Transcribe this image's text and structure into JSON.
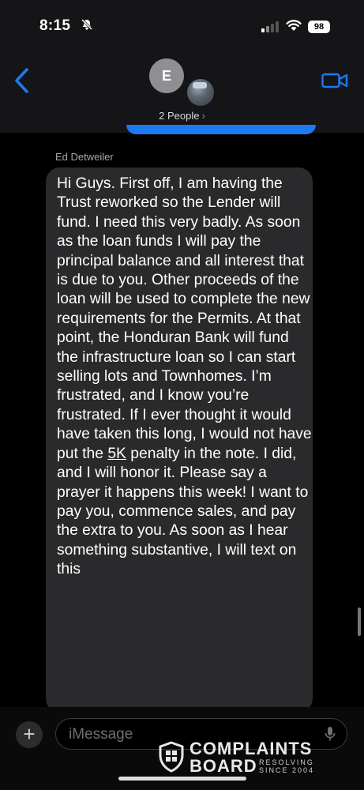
{
  "status_bar": {
    "time": "8:15",
    "battery": "98"
  },
  "header": {
    "avatar_initial": "E",
    "group_label": "2 People",
    "group_chevron": "›",
    "back_icon": "chevron-left-icon",
    "video_icon": "video-camera-icon"
  },
  "thread": {
    "sender_name": "Ed Detweiler",
    "message_before_underline": "Hi Guys.  First off, I am having the Trust reworked so the Lender will fund.  I need this very badly.  As soon as the loan funds I will pay the principal balance and all interest that is due to you.  Other proceeds of the loan will be used to complete the new requirements for the Permits.  At that point, the Honduran Bank will fund the infrastructure loan so I can start selling lots and Townhomes.  I’m frustrated, and I know you’re frustrated.  If I ever thought it would have taken this long, I would not have put the ",
    "message_underlined": "5K",
    "message_after_underline": " penalty in the note.  I did, and I will honor it.  Please say a prayer it happens this week!  I want to pay you, commence sales, and pay the extra to you.  As soon as I hear something substantive, I will text on this"
  },
  "composer": {
    "plus_label": "+",
    "placeholder": "iMessage"
  },
  "watermark": {
    "line1": "COMPLAINTS",
    "line2": "BOARD",
    "tag1": "RESOLVING",
    "tag2": "SINCE 2004"
  },
  "colors": {
    "accent_blue": "#1c79f2",
    "bubble_gray": "#2a2a2c",
    "background": "#000000"
  }
}
